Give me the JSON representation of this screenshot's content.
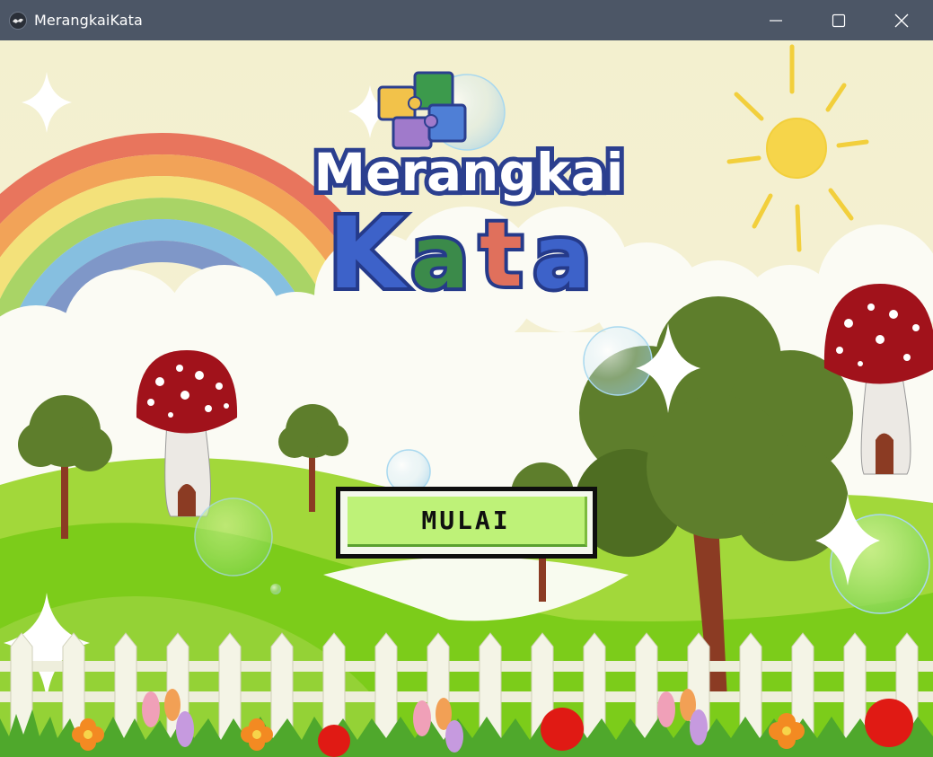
{
  "window": {
    "title": "MerangkaiKata",
    "controls": [
      "minimize",
      "maximize",
      "close"
    ]
  },
  "logo": {
    "line1": "Merangkai",
    "line2": [
      "K",
      "a",
      "t",
      "a"
    ],
    "icon": "puzzle-pieces-icon"
  },
  "start_button": {
    "label": "MULAI"
  },
  "colors": {
    "titlebar": "#4c5666",
    "button_fill": "#bef278",
    "button_border": "#0e0e0e",
    "logo_blue": "#3d62c9",
    "logo_green": "#3b8a4a",
    "logo_red": "#e0705c"
  }
}
